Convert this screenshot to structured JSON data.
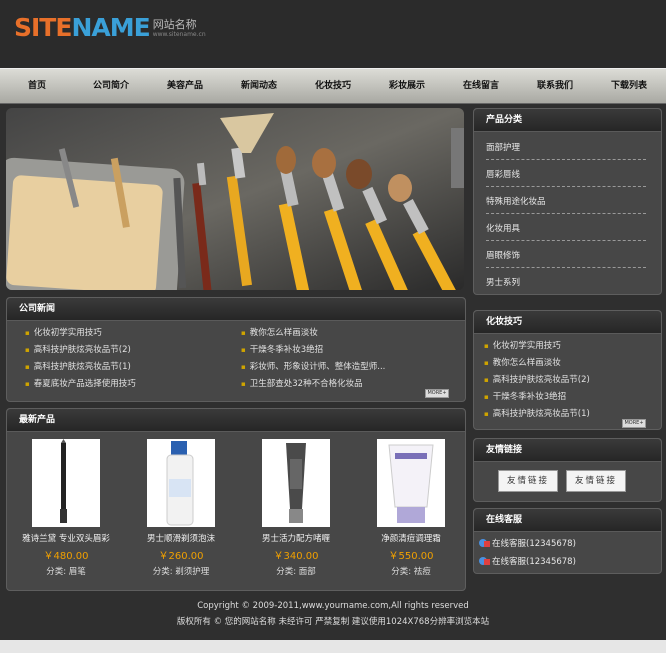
{
  "logo": {
    "brand_a": "SITE",
    "brand_b": "NAME",
    "cn": "网站名称",
    "url": "www.sitename.cn"
  },
  "nav": [
    "首页",
    "公司简介",
    "美容产品",
    "新闻动态",
    "化妆技巧",
    "彩妆展示",
    "在线留言",
    "联系我们",
    "下载列表"
  ],
  "company_news": {
    "title": "公司新闻",
    "items": [
      "化妆初学实用技巧",
      "教你怎么样画淡妆",
      "高科技护肤炫亮妆品节(2)",
      "干燥冬季补妆3绝招",
      "高科技护肤炫亮妆品节(1)",
      "彩妆师、形象设计师、整体造型师...",
      "春夏底妆产品选择使用技巧",
      "卫生部查处32种不合格化妆品"
    ],
    "more": "MORE+"
  },
  "products": {
    "title": "最新产品",
    "items": [
      {
        "name": "雅诗兰黛 专业双头眉彩",
        "price": "￥480.00",
        "category": "分类: 眉笔"
      },
      {
        "name": "男士顺滑剃须泡沫",
        "price": "￥260.00",
        "category": "分类: 剃须护理"
      },
      {
        "name": "男士活力配方啫喱",
        "price": "￥340.00",
        "category": "分类: 面部"
      },
      {
        "name": "净颜清痘调理霜",
        "price": "￥550.00",
        "category": "分类: 祛痘"
      }
    ]
  },
  "categories": {
    "title": "产品分类",
    "items": [
      "面部护理",
      "唇彩唇线",
      "特殊用途化妆品",
      "化妆用具",
      "眉眼修饰",
      "男士系列"
    ]
  },
  "tips": {
    "title": "化妆技巧",
    "items": [
      "化妆初学实用技巧",
      "教你怎么样画淡妆",
      "高科技护肤炫亮妆品节(2)",
      "干燥冬季补妆3绝招",
      "高科技护肤炫亮妆品节(1)"
    ],
    "more": "MORE+"
  },
  "links": {
    "title": "友情链接",
    "items": [
      "友情链接",
      "友情链接"
    ]
  },
  "service": {
    "title": "在线客服",
    "items": [
      "在线客服(12345678)",
      "在线客服(12345678)"
    ]
  },
  "footer": {
    "line1": "Copyright © 2009-2011,www.yourname.com,All rights reserved",
    "line2": "版权所有 © 您的网站名称  未经许可  严禁复制  建议使用1024X768分辨率浏览本站"
  },
  "colors": {
    "accent": "#f0a000",
    "logo_orange": "#e8702a",
    "logo_blue": "#3aa0d8",
    "background": "#2f2f2f"
  }
}
